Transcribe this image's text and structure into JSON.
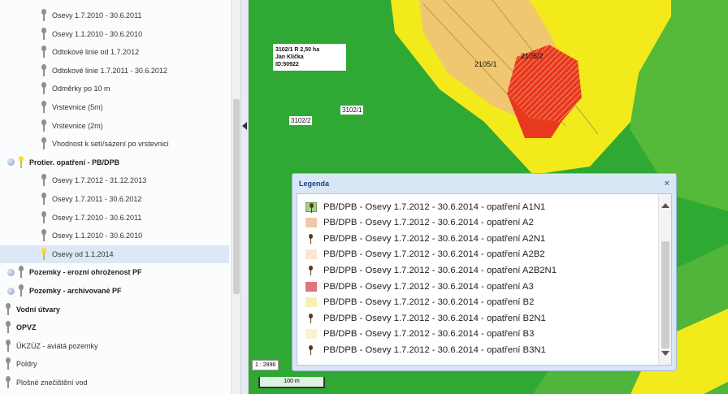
{
  "tree": {
    "items": [
      {
        "label": "Osevy 1.7.2010 - 30.6.2011",
        "level": 2,
        "pin": "gray"
      },
      {
        "label": "Osevy 1.1.2010 - 30.6.2010",
        "level": 2,
        "pin": "gray"
      },
      {
        "label": "Odtokové linie od 1.7.2012",
        "level": 2,
        "pin": "gray"
      },
      {
        "label": "Odtokové linie 1.7.2011 - 30.6.2012",
        "level": 2,
        "pin": "gray"
      },
      {
        "label": "Odměrky po 10 m",
        "level": 2,
        "pin": "gray"
      },
      {
        "label": "Vrstevnice (5m)",
        "level": 2,
        "pin": "gray"
      },
      {
        "label": "Vrstevnice (2m)",
        "level": 2,
        "pin": "gray"
      },
      {
        "label": "Vhodnost k setí/sázení po vrstevnici",
        "level": 2,
        "pin": "gray"
      },
      {
        "label": "Protier. opatření - PB/DPB",
        "level": 1,
        "pin": "yellow",
        "bold": true,
        "expander": true
      },
      {
        "label": "Osevy 1.7.2012 - 31.12.2013",
        "level": 2,
        "pin": "gray"
      },
      {
        "label": "Osevy 1.7.2011 - 30.6.2012",
        "level": 2,
        "pin": "gray"
      },
      {
        "label": "Osevy 1.7.2010 - 30.6.2011",
        "level": 2,
        "pin": "gray"
      },
      {
        "label": "Osevy 1.1.2010 - 30.6.2010",
        "level": 2,
        "pin": "gray"
      },
      {
        "label": "Osevy od 1.1.2014",
        "level": 2,
        "pin": "yellow",
        "selected": true
      },
      {
        "label": "Pozemky - erozní ohroženost PF",
        "level": 1,
        "pin": "gray",
        "bold": true,
        "expander": true
      },
      {
        "label": "Pozemky - archivované PF",
        "level": 1,
        "pin": "gray",
        "bold": true,
        "expander": true
      },
      {
        "label": "Vodní útvary",
        "level": 0,
        "pin": "gray",
        "bold": true
      },
      {
        "label": "OPVZ",
        "level": 0,
        "pin": "gray",
        "bold": true
      },
      {
        "label": "ÚKZÚZ - aviátá pozemky",
        "level": 0,
        "pin": "gray"
      },
      {
        "label": "Poldry",
        "level": 0,
        "pin": "gray"
      },
      {
        "label": "Plošné znečištění vod",
        "level": 0,
        "pin": "gray"
      }
    ]
  },
  "map": {
    "parcel_info": [
      "3102/1 R 2,50 ha",
      "Jan Klička",
      "ID:50922"
    ],
    "labels": {
      "l2105_2": "2105/2",
      "l2105_1": "2105/1",
      "l3102_1": "3102/1",
      "l3102_2": "3102/2"
    },
    "scale_ratio": "1 : 2896",
    "scale_bar": "100 m",
    "colors": {
      "field_green": "#2fa934",
      "light_green": "#5bbf3a",
      "yellow": "#f3ea1c",
      "tan": "#f0c770",
      "red": "#e8381e",
      "hatched_red": "#d9322a"
    }
  },
  "legend": {
    "title": "Legenda",
    "close_icon": "×",
    "items": [
      {
        "label": "PB/DPB - Osevy 1.7.2012 - 30.6.2014 - opatření A1N1",
        "swatch": "pin-icon-green"
      },
      {
        "label": "PB/DPB - Osevy 1.7.2012 - 30.6.2014 - opatření A2",
        "swatch": "#f0c7a9"
      },
      {
        "label": "PB/DPB - Osevy 1.7.2012 - 30.6.2014 - opatření A2N1",
        "swatch": "pin-icon"
      },
      {
        "label": "PB/DPB - Osevy 1.7.2012 - 30.6.2014 - opatření A2B2",
        "swatch": "#fbe5d3"
      },
      {
        "label": "PB/DPB - Osevy 1.7.2012 - 30.6.2014 - opatření A2B2N1",
        "swatch": "pin-icon"
      },
      {
        "label": "PB/DPB - Osevy 1.7.2012 - 30.6.2014 - opatření A3",
        "swatch": "#e0767a"
      },
      {
        "label": "PB/DPB - Osevy 1.7.2012 - 30.6.2014 - opatření B2",
        "swatch": "#f6f1b2"
      },
      {
        "label": "PB/DPB - Osevy 1.7.2012 - 30.6.2014 - opatření B2N1",
        "swatch": "pin-icon"
      },
      {
        "label": "PB/DPB - Osevy 1.7.2012 - 30.6.2014 - opatření B3",
        "swatch": "#fbf2cf"
      },
      {
        "label": "PB/DPB - Osevy 1.7.2012 - 30.6.2014 - opatření B3N1",
        "swatch": "pin-icon"
      }
    ]
  }
}
